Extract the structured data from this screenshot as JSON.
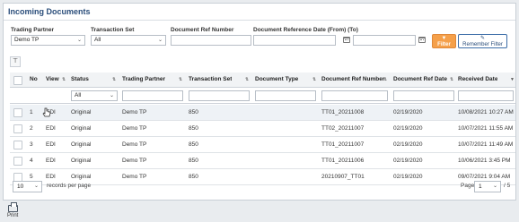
{
  "panel": {
    "title": "Incoming Documents"
  },
  "filters": {
    "trading_partner": {
      "label": "Trading Partner",
      "value": "Demo TP"
    },
    "transaction_set": {
      "label": "Transaction Set",
      "value": "All"
    },
    "doc_ref_number": {
      "label": "Document Ref Number",
      "value": ""
    },
    "doc_ref_date": {
      "label": "Document Reference Date (From) (To)",
      "from": "",
      "to": ""
    },
    "filter_button": "Filter",
    "remember_button": "Remember Filter"
  },
  "table": {
    "columns": [
      "No",
      "View",
      "Status",
      "Trading Partner",
      "Transaction Set",
      "Document Type",
      "Document Ref Number",
      "Document Ref Date",
      "Received Date"
    ],
    "status_filter": "All",
    "rows": [
      {
        "no": "1",
        "view": "EDI",
        "status": "Original",
        "partner": "Demo TP",
        "set": "850",
        "type": "",
        "ref": "TT01_20211008",
        "ref_date": "02/19/2020",
        "received": "10/08/2021 10:27 AM"
      },
      {
        "no": "2",
        "view": "EDI",
        "status": "Original",
        "partner": "Demo TP",
        "set": "850",
        "type": "",
        "ref": "TT02_20211007",
        "ref_date": "02/19/2020",
        "received": "10/07/2021 11:55 AM"
      },
      {
        "no": "3",
        "view": "EDI",
        "status": "Original",
        "partner": "Demo TP",
        "set": "850",
        "type": "",
        "ref": "TT01_20211007",
        "ref_date": "02/19/2020",
        "received": "10/07/2021 11:49 AM"
      },
      {
        "no": "4",
        "view": "EDI",
        "status": "Original",
        "partner": "Demo TP",
        "set": "850",
        "type": "",
        "ref": "TT01_20211006",
        "ref_date": "02/19/2020",
        "received": "10/06/2021 3:45 PM"
      },
      {
        "no": "5",
        "view": "EDI",
        "status": "Original",
        "partner": "Demo TP",
        "set": "850",
        "type": "",
        "ref": "20210907_TT01",
        "ref_date": "02/19/2020",
        "received": "09/07/2021 9:04 AM"
      }
    ]
  },
  "pager": {
    "per_page": "10",
    "per_page_label": "records per page",
    "page_label": "Page",
    "page_value": "1",
    "page_total": "/ 5"
  },
  "footer": {
    "print_label": "Print"
  },
  "colors": {
    "accent": "#f5a04a",
    "link": "#3b6fb0",
    "title": "#2a4d7a"
  }
}
